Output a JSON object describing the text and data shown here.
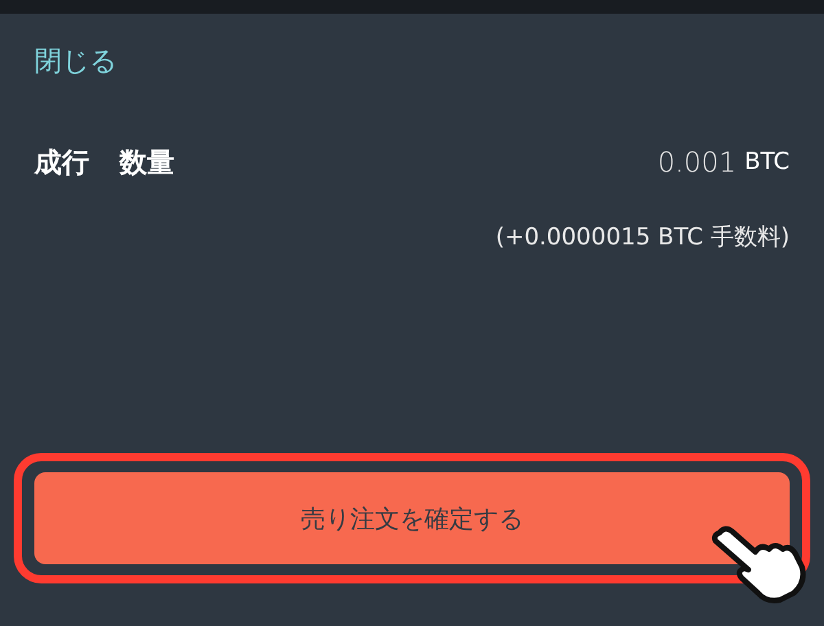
{
  "close_link": "閉じる",
  "order": {
    "type": "成行",
    "label": "数量",
    "amount": "0.001",
    "unit": "BTC",
    "fee": "(+0.0000015 BTC 手数料)"
  },
  "confirm_button": {
    "label": "売り注文を確定する",
    "highlighted": true
  }
}
